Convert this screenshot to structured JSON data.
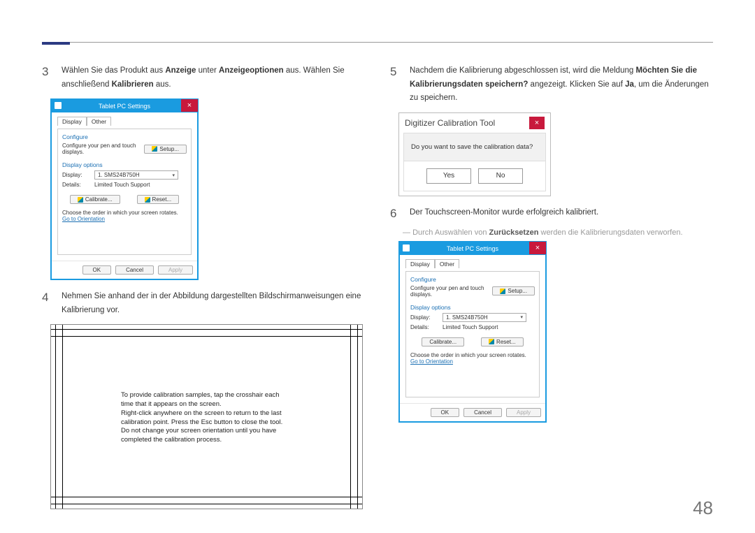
{
  "page_number": "48",
  "steps": {
    "s3": {
      "num": "3",
      "t1": "Wählen Sie das Produkt aus ",
      "b1": "Anzeige",
      "t2": " unter ",
      "b2": "Anzeigeoptionen",
      "t3": " aus. Wählen Sie anschließend ",
      "b3": "Kalibrieren",
      "t4": " aus."
    },
    "s4": {
      "num": "4",
      "text": "Nehmen Sie anhand der in der Abbildung dargestellten Bildschirmanweisungen eine Kalibrierung vor."
    },
    "s5": {
      "num": "5",
      "t1": "Nachdem die Kalibrierung abgeschlossen ist, wird die Meldung ",
      "b1": "Möchten Sie die Kalibrierungsdaten speichern?",
      "t2": " angezeigt. Klicken Sie auf ",
      "b2": "Ja",
      "t3": ", um die Änderungen zu speichern."
    },
    "s6": {
      "num": "6",
      "text": "Der Touchscreen-Monitor wurde erfolgreich kalibriert."
    }
  },
  "note": {
    "dash": "―",
    "t1": "Durch Auswählen von ",
    "b1": "Zurücksetzen",
    "t2": " werden die Kalibrierungsdaten verworfen."
  },
  "win": {
    "title": "Tablet PC Settings",
    "close": "×",
    "tab_display": "Display",
    "tab_other": "Other",
    "configure": "Configure",
    "configure_desc": "Configure your pen and touch displays.",
    "setup_btn": "Setup...",
    "display_options": "Display options",
    "display_lbl": "Display:",
    "display_val": "1. SMS24B750H",
    "details_lbl": "Details:",
    "details_val": "Limited Touch Support",
    "calibrate_btn": "Calibrate...",
    "reset_btn": "Reset...",
    "order_text": "Choose the order in which your screen rotates.",
    "orientation_link": "Go to Orientation",
    "ok": "OK",
    "cancel": "Cancel",
    "apply": "Apply"
  },
  "calib_text": "To provide calibration samples, tap the crosshair each time that it appears on the screen.\nRight-click anywhere on the screen to return to the last calibration point. Press the Esc button to close the tool. Do not change your screen orientation until you have completed the calibration process.",
  "dlg": {
    "title": "Digitizer Calibration Tool",
    "close": "×",
    "question": "Do you want to save the calibration data?",
    "yes": "Yes",
    "no": "No"
  }
}
